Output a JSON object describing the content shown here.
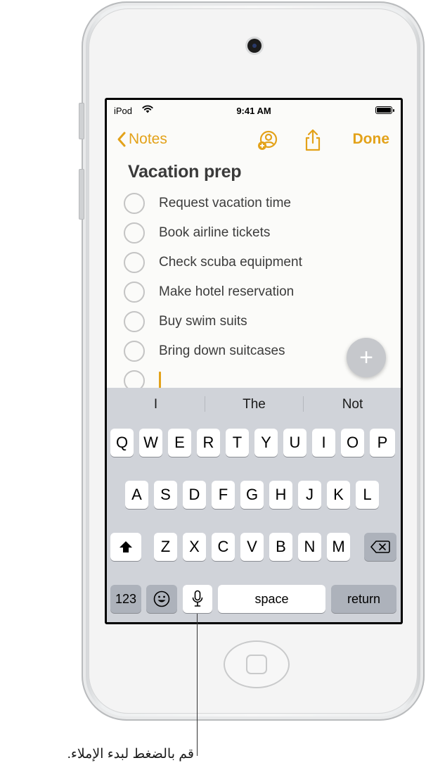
{
  "status_bar": {
    "carrier": "iPod",
    "time": "9:41 AM"
  },
  "nav": {
    "back_label": "Notes",
    "done_label": "Done"
  },
  "note": {
    "title": "Vacation prep",
    "items": [
      "Request vacation time",
      "Book airline tickets",
      "Check scuba equipment",
      "Make hotel reservation",
      "Buy swim suits",
      "Bring down suitcases"
    ]
  },
  "keyboard": {
    "suggestions": [
      "I",
      "The",
      "Not"
    ],
    "row1": [
      "Q",
      "W",
      "E",
      "R",
      "T",
      "Y",
      "U",
      "I",
      "O",
      "P"
    ],
    "row2": [
      "A",
      "S",
      "D",
      "F",
      "G",
      "H",
      "J",
      "K",
      "L"
    ],
    "row3": [
      "Z",
      "X",
      "C",
      "V",
      "B",
      "N",
      "M"
    ],
    "numbers_label": "123",
    "space_label": "space",
    "return_label": "return"
  },
  "callout": {
    "text": "قم بالضغط لبدء الإملاء."
  },
  "colors": {
    "accent": "#e3a21a",
    "keyboard_bg": "#d0d3d9",
    "dark_key": "#adb2bb"
  },
  "icons": [
    "wifi-icon",
    "battery-icon",
    "chevron-left-icon",
    "share-people-icon",
    "share-icon",
    "plus-icon",
    "shift-icon",
    "delete-icon",
    "emoji-icon",
    "microphone-icon"
  ]
}
